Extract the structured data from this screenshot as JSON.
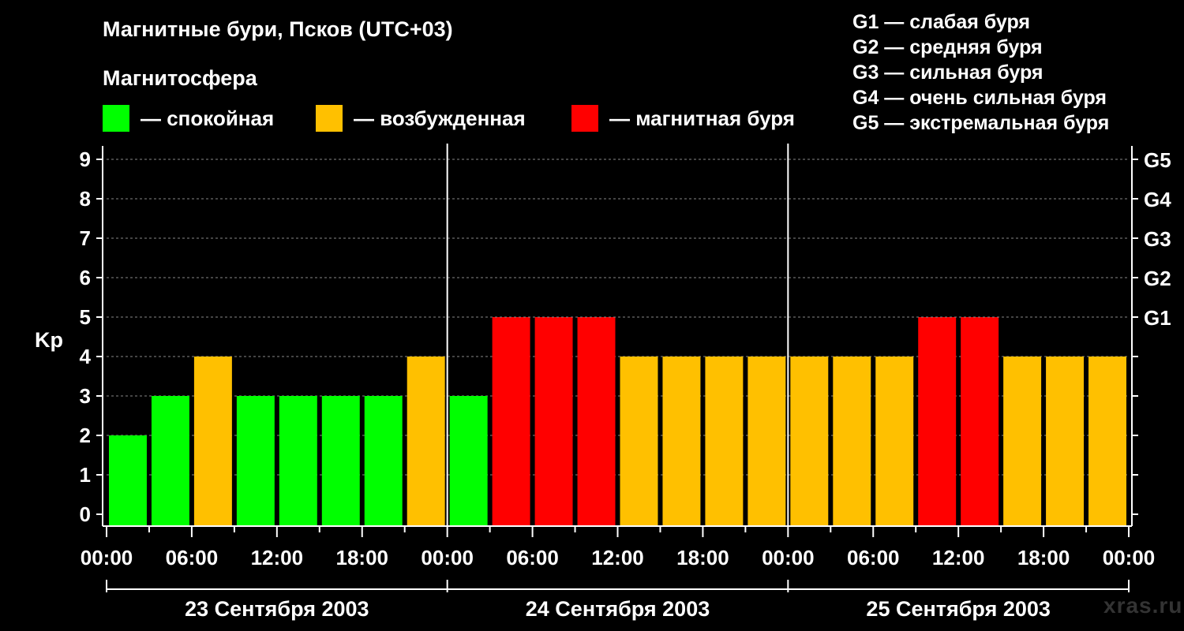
{
  "header": {
    "title": "Магнитные бури, Псков (UTC+03)",
    "subtitle": "Магнитосфера"
  },
  "legend": [
    {
      "label": "— спокойная",
      "color": "#00ff00"
    },
    {
      "label": "— возбужденная",
      "color": "#ffc000"
    },
    {
      "label": "— магнитная буря",
      "color": "#ff0000"
    }
  ],
  "g_legend": [
    "G1 — слабая буря",
    "G2 — средняя буря",
    "G3 — сильная буря",
    "G4 — очень сильная буря",
    "G5 — экстремальная буря"
  ],
  "watermark": "xras.ru",
  "chart_data": {
    "type": "bar",
    "ylabel": "Kp",
    "ylim": [
      0,
      9
    ],
    "yticks": [
      "0",
      "1",
      "2",
      "3",
      "4",
      "5",
      "6",
      "7",
      "8",
      "9"
    ],
    "right_ticks": [
      {
        "label": "G1",
        "value": 5
      },
      {
        "label": "G2",
        "value": 6
      },
      {
        "label": "G3",
        "value": 7
      },
      {
        "label": "G4",
        "value": 8
      },
      {
        "label": "G5",
        "value": 9
      }
    ],
    "xticks": [
      "00:00",
      "06:00",
      "12:00",
      "18:00",
      "00:00",
      "06:00",
      "12:00",
      "18:00",
      "00:00",
      "06:00",
      "12:00",
      "18:00",
      "00:00"
    ],
    "days": [
      "23 Сентября 2003",
      "24 Сентября 2003",
      "25 Сентября 2003"
    ],
    "interval_hours": 3,
    "values": [
      2,
      3,
      4,
      3,
      3,
      3,
      3,
      4,
      3,
      5,
      5,
      5,
      4,
      4,
      4,
      4,
      4,
      4,
      4,
      5,
      5,
      4,
      4,
      4
    ],
    "colors": {
      "quiet": "#00ff00",
      "unsettled": "#ffc000",
      "storm": "#ff0000"
    },
    "grid": "dashed horizontal",
    "axis_color": "#ffffff",
    "grid_color": "#888888"
  }
}
